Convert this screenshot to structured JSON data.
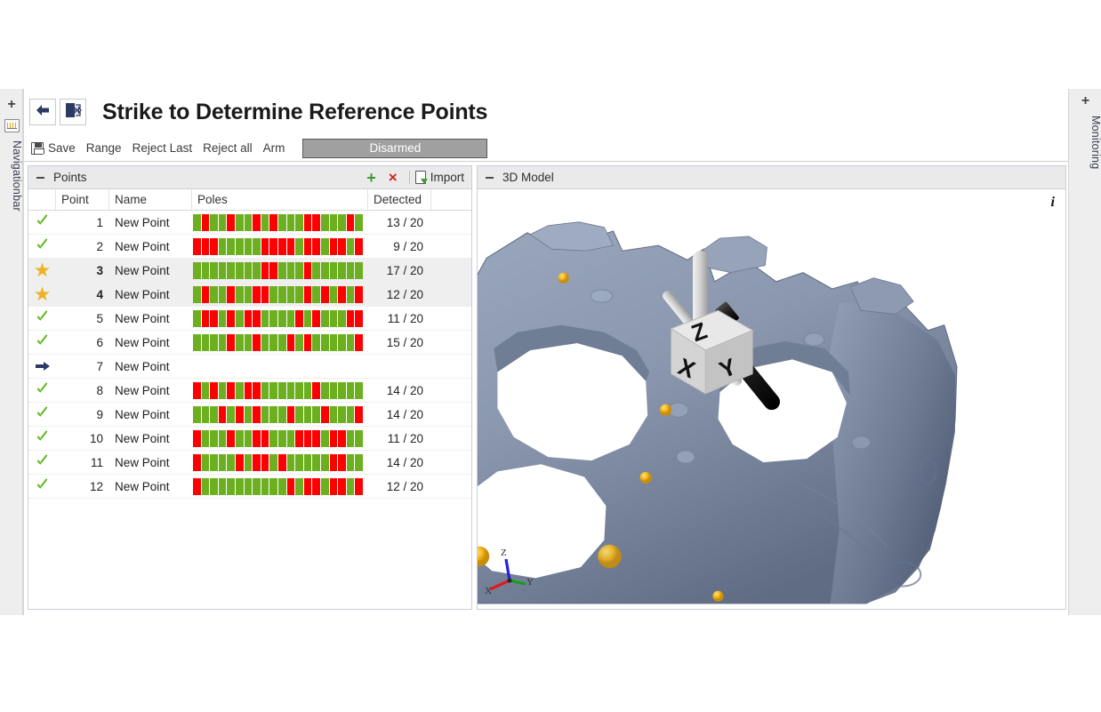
{
  "window": {
    "title": "Strike to Determine Reference Points"
  },
  "nav": {
    "back_icon": "back-arrow-icon",
    "exit_icon": "exit-door-icon"
  },
  "left_rail": {
    "plus": "+",
    "label": "Navigationbar",
    "icon": "navigationbar-icon"
  },
  "right_rail": {
    "plus": "+",
    "label": "Monitoring"
  },
  "toolbar": {
    "save_label": "Save",
    "range_label": "Range",
    "reject_last_label": "Reject Last",
    "reject_all_label": "Reject all",
    "arm_label": "Arm",
    "status_label": "Disarmed",
    "status_bg": "#a0a0a0",
    "status_fg": "#ffffff"
  },
  "points_panel": {
    "title": "Points",
    "add_label": "+",
    "delete_label": "×",
    "import_label": "Import",
    "columns": [
      "",
      "Point",
      "Name",
      "Poles",
      "Detected",
      ""
    ],
    "rows": [
      {
        "status": "check",
        "point": "1",
        "name": "New Point",
        "detected": "13 / 20",
        "poles": [
          1,
          0,
          1,
          1,
          0,
          1,
          1,
          0,
          1,
          0,
          1,
          1,
          1,
          0,
          0,
          1,
          1,
          1,
          0,
          1
        ]
      },
      {
        "status": "check",
        "point": "2",
        "name": "New Point",
        "detected": "9 / 20",
        "poles": [
          0,
          0,
          0,
          1,
          1,
          1,
          1,
          1,
          0,
          0,
          0,
          0,
          1,
          0,
          0,
          1,
          0,
          0,
          1,
          0
        ]
      },
      {
        "status": "star",
        "point": "3",
        "name": "New Point",
        "detected": "17 / 20",
        "poles": [
          1,
          1,
          1,
          1,
          1,
          1,
          1,
          1,
          0,
          0,
          1,
          1,
          1,
          0,
          1,
          1,
          1,
          1,
          1,
          1
        ]
      },
      {
        "status": "star",
        "point": "4",
        "name": "New Point",
        "detected": "12 / 20",
        "poles": [
          1,
          0,
          1,
          1,
          0,
          1,
          1,
          0,
          0,
          1,
          1,
          1,
          1,
          0,
          1,
          0,
          1,
          0,
          1,
          0
        ]
      },
      {
        "status": "check",
        "point": "5",
        "name": "New Point",
        "detected": "11 / 20",
        "poles": [
          1,
          0,
          0,
          1,
          0,
          1,
          0,
          0,
          1,
          1,
          1,
          1,
          0,
          1,
          0,
          1,
          1,
          1,
          0,
          0
        ]
      },
      {
        "status": "check",
        "point": "6",
        "name": "New Point",
        "detected": "15 / 20",
        "poles": [
          1,
          1,
          1,
          1,
          0,
          1,
          1,
          0,
          1,
          1,
          1,
          0,
          1,
          0,
          1,
          1,
          1,
          1,
          1,
          0
        ]
      },
      {
        "status": "arrow",
        "point": "7",
        "name": "New Point",
        "detected": "",
        "poles": []
      },
      {
        "status": "check",
        "point": "8",
        "name": "New Point",
        "detected": "14 / 20",
        "poles": [
          0,
          1,
          0,
          1,
          0,
          1,
          0,
          0,
          1,
          1,
          1,
          1,
          1,
          1,
          0,
          1,
          1,
          1,
          1,
          1
        ]
      },
      {
        "status": "check",
        "point": "9",
        "name": "New Point",
        "detected": "14 / 20",
        "poles": [
          1,
          1,
          1,
          0,
          1,
          0,
          1,
          0,
          1,
          1,
          1,
          0,
          1,
          1,
          1,
          0,
          1,
          1,
          1,
          0
        ]
      },
      {
        "status": "check",
        "point": "10",
        "name": "New Point",
        "detected": "11 / 20",
        "poles": [
          0,
          1,
          1,
          1,
          0,
          1,
          1,
          0,
          0,
          1,
          1,
          1,
          0,
          0,
          0,
          1,
          0,
          0,
          1,
          1
        ]
      },
      {
        "status": "check",
        "point": "11",
        "name": "New Point",
        "detected": "14 / 20",
        "poles": [
          0,
          1,
          1,
          1,
          1,
          0,
          1,
          0,
          0,
          1,
          0,
          1,
          1,
          1,
          1,
          1,
          0,
          0,
          1,
          1
        ]
      },
      {
        "status": "check",
        "point": "12",
        "name": "New Point",
        "detected": "12 / 20",
        "poles": [
          0,
          1,
          1,
          1,
          1,
          1,
          1,
          1,
          1,
          1,
          1,
          0,
          1,
          0,
          0,
          1,
          0,
          0,
          1,
          0
        ]
      }
    ],
    "colors": {
      "pole_ok": "#6CAF1F",
      "pole_fail": "#FF0000"
    }
  },
  "model_panel": {
    "title": "3D Model",
    "info_icon": "info-icon",
    "axes": {
      "x": "X",
      "y": "Y",
      "z": "Z",
      "x_color": "#e01b1b",
      "y_color": "#14a014",
      "z_color": "#2222dd"
    },
    "cube_faces": {
      "top": "Z",
      "left": "X",
      "right": "Y"
    }
  }
}
